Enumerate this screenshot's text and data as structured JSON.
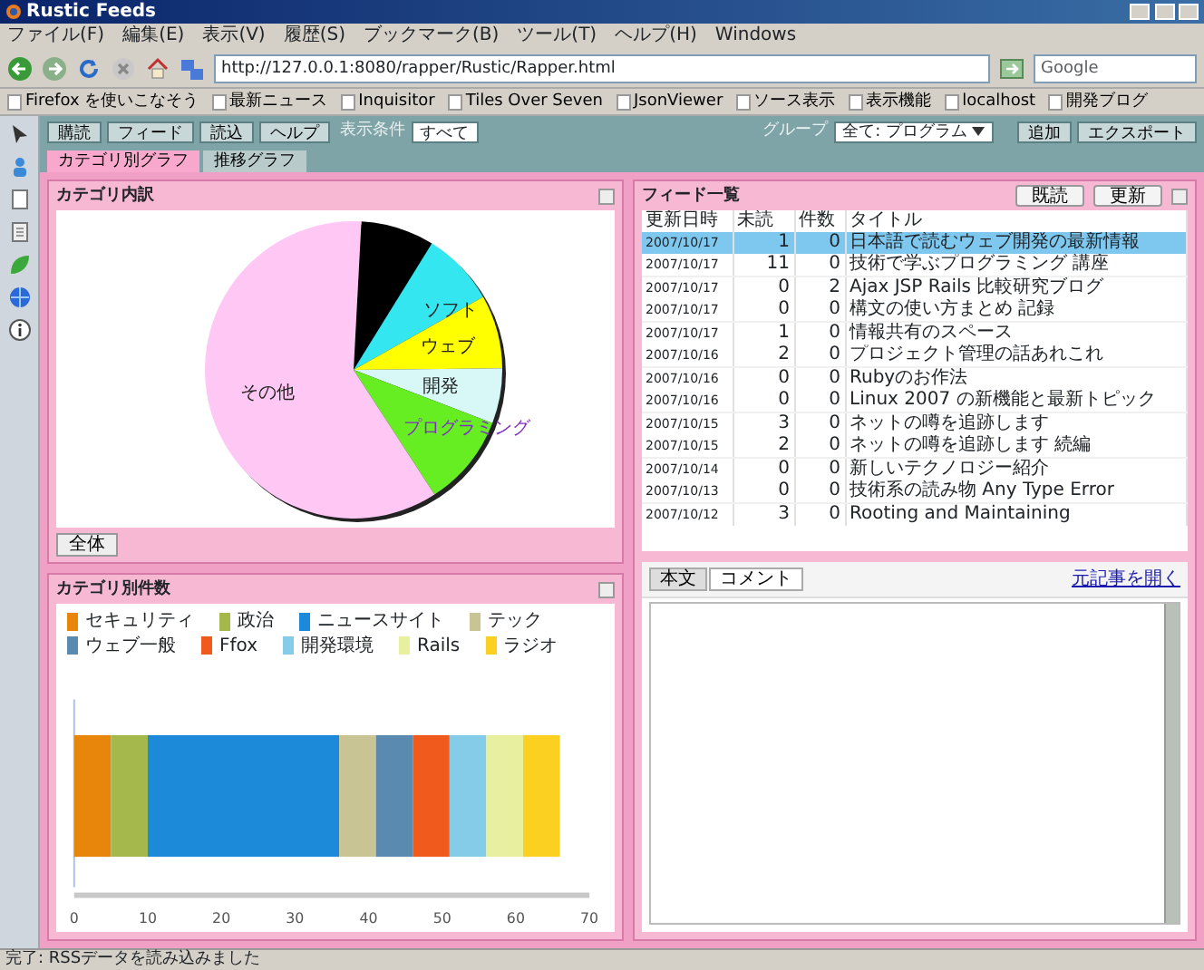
{
  "window": {
    "title": "Rustic Feeds"
  },
  "menu": [
    "ファイル(F)",
    "編集(E)",
    "表示(V)",
    "履歴(S)",
    "ブックマーク(B)",
    "ツール(T)",
    "ヘルプ(H)",
    "Windows"
  ],
  "address": {
    "value": "http://127.0.0.1:8080/rapper/Rustic/Rapper.html"
  },
  "search": {
    "placeholder": "Google"
  },
  "bookmarks": [
    "Firefox を使いこなそう",
    "最新ニュース",
    "Inquisitor",
    "Tiles Over Seven",
    "JsonViewer",
    "ソース表示",
    "表示機能",
    "localhost",
    "開発ブログ"
  ],
  "toolbar": {
    "buttons": [
      "購読",
      "フィード",
      "読込",
      "ヘルプ"
    ],
    "filter_label": "表示条件",
    "filter_value": "すべて",
    "group_label": "グループ",
    "group_value": "全て: プログラム",
    "right_buttons": [
      "追加",
      "エクスポート"
    ]
  },
  "tabs": [
    {
      "label": "カテゴリ別グラフ",
      "selected": true
    },
    {
      "label": "推移グラフ",
      "selected": false
    }
  ],
  "pie_panel": {
    "title": "カテゴリ内訳",
    "button": "全体",
    "chart_data": {
      "type": "pie",
      "categories": [
        null,
        "ソフト",
        "ウェブ",
        "開発",
        "プログラミング",
        "その他"
      ],
      "values": [
        8,
        8,
        8,
        6,
        10,
        60
      ],
      "colors": [
        "#000000",
        "#33e6f0",
        "#ffff00",
        "#d8f8f8",
        "#66ee22",
        "#ffc8f4"
      ]
    }
  },
  "bar_panel": {
    "title": "カテゴリ別件数",
    "chart_data": {
      "type": "bar",
      "orientation": "horizontal",
      "stacked": true,
      "legend": true,
      "series": [
        {
          "name": "セキュリティ",
          "color": "#e8860c",
          "values": [
            5
          ]
        },
        {
          "name": "政治",
          "color": "#a4b84c",
          "values": [
            5
          ]
        },
        {
          "name": "ニュースサイト",
          "color": "#1c8ad8",
          "values": [
            26
          ]
        },
        {
          "name": "テック",
          "color": "#c8c494",
          "values": [
            5
          ]
        },
        {
          "name": "ウェブ一般",
          "color": "#5a8ab0",
          "values": [
            5
          ]
        },
        {
          "name": "Ffox",
          "color": "#f05a1c",
          "values": [
            5
          ]
        },
        {
          "name": "開発環境",
          "color": "#84cce8",
          "values": [
            5
          ]
        },
        {
          "name": "Rails",
          "color": "#e8f0a0",
          "values": [
            5
          ]
        },
        {
          "name": "ラジオ",
          "color": "#fcd020",
          "values": [
            5
          ]
        }
      ],
      "xlim": [
        0,
        70
      ],
      "xticks": [
        0,
        10,
        20,
        30,
        40,
        50,
        60,
        70
      ]
    }
  },
  "feed_panel": {
    "title": "フィード一覧",
    "buttons": [
      "既読",
      "更新"
    ],
    "columns": [
      "更新日時",
      "未読",
      "件数",
      "タイトル"
    ],
    "rows": [
      {
        "cells": [
          "2007/10/17",
          "1",
          "0",
          "日本語で読むウェブ開発の最新情報"
        ],
        "selected": true
      },
      {
        "cells": [
          "2007/10/17",
          "11",
          "0",
          "技術で学ぶプログラミング 講座"
        ],
        "selected": false
      },
      {
        "cells": [
          "2007/10/17",
          "0",
          "2",
          "Ajax JSP Rails 比較研究ブログ"
        ],
        "selected": false
      },
      {
        "cells": [
          "2007/10/17",
          "0",
          "0",
          "構文の使い方まとめ 記録"
        ],
        "selected": false
      },
      {
        "cells": [
          "2007/10/17",
          "1",
          "0",
          "情報共有のスペース"
        ],
        "selected": false
      },
      {
        "cells": [
          "2007/10/16",
          "2",
          "0",
          "プロジェクト管理の話あれこれ"
        ],
        "selected": false
      },
      {
        "cells": [
          "2007/10/16",
          "0",
          "0",
          "Rubyのお作法"
        ],
        "selected": false
      },
      {
        "cells": [
          "2007/10/16",
          "0",
          "0",
          "Linux 2007 の新機能と最新トピック"
        ],
        "selected": false
      },
      {
        "cells": [
          "2007/10/15",
          "3",
          "0",
          "ネットの噂を追跡します"
        ],
        "selected": false
      },
      {
        "cells": [
          "2007/10/15",
          "2",
          "0",
          "ネットの噂を追跡します 続編"
        ],
        "selected": false
      },
      {
        "cells": [
          "2007/10/14",
          "0",
          "0",
          "新しいテクノロジー紹介"
        ],
        "selected": false
      },
      {
        "cells": [
          "2007/10/13",
          "0",
          "0",
          "技術系の読み物 Any Type Error"
        ],
        "selected": false
      },
      {
        "cells": [
          "2007/10/12",
          "3",
          "0",
          "Rooting and Maintaining"
        ],
        "selected": false
      }
    ]
  },
  "reader": {
    "tabs": [
      {
        "label": "本文",
        "selected": true
      },
      {
        "label": "コメント",
        "selected": false
      }
    ],
    "link": "元記事を開く"
  },
  "status_bar": "完了: RSSデータを読み込みました"
}
